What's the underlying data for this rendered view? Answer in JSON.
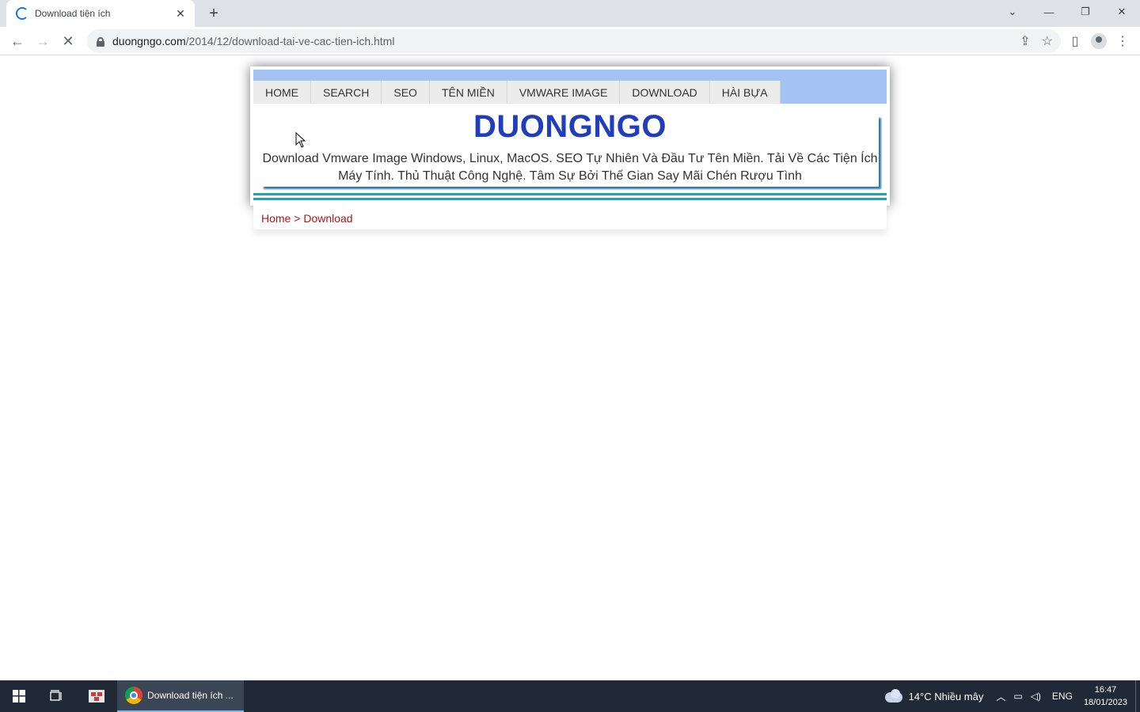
{
  "browser": {
    "tab_title": "Download tiện ích",
    "tab_close": "✕",
    "new_tab": "+",
    "url_host": "duongngo.com",
    "url_path": "/2014/12/download-tai-ve-cac-tien-ich.html"
  },
  "site": {
    "nav": [
      "HOME",
      "SEARCH",
      "SEO",
      "TÊN MIỀN",
      "VMWARE IMAGE",
      "DOWNLOAD",
      "HÀI BỰA"
    ],
    "title": "DUONGNGO",
    "description_line1": "Download Vmware Image Windows, Linux, MacOS. SEO Tự Nhiên Và Đầu Tư Tên Miền. Tải Về Các Tiện Ích",
    "description_line2": "Máy Tính. Thủ Thuật Công Nghệ. Tâm Sự Bởi Thế Gian Say Mãi Chén Rượu Tình",
    "breadcrumb_home": "Home",
    "breadcrumb_sep": " > ",
    "breadcrumb_current": "Download"
  },
  "taskbar": {
    "chrome_label": "Download tiện ích ...",
    "weather": "14°C  Nhiều mây",
    "lang": "ENG",
    "time": "16:47",
    "date": "18/01/2023"
  },
  "colors": {
    "nav_bar": "#a4c3f5",
    "title": "#1f3dbd",
    "breadcrumb": "#aa1818",
    "accent_lines": "#2e9db0"
  }
}
